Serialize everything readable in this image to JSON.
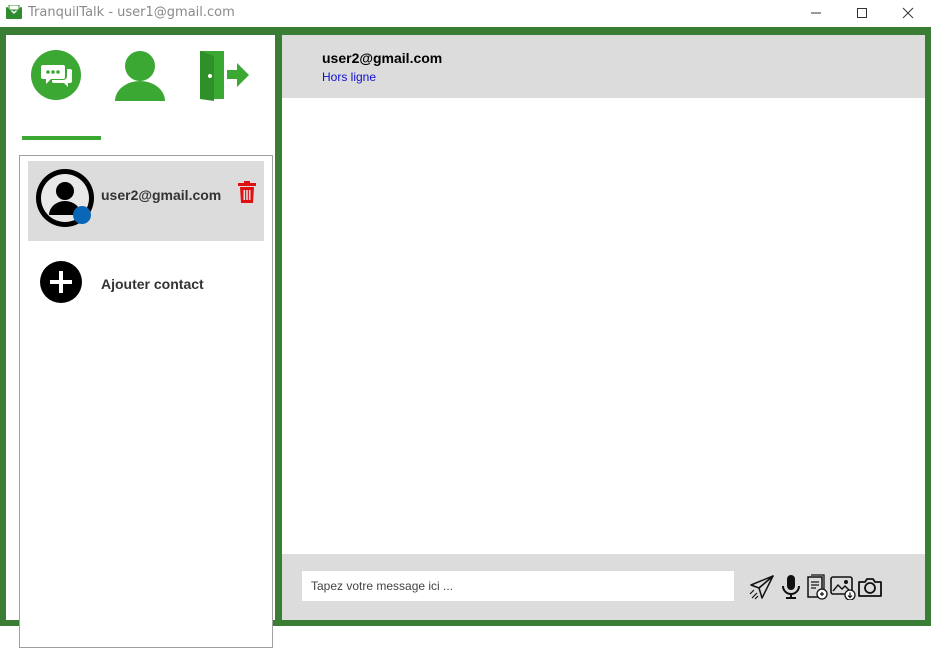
{
  "window": {
    "title": "TranquilTalk - user1@gmail.com",
    "controls": [
      "minimize-icon",
      "maximize-icon",
      "close-icon"
    ]
  },
  "sidebar": {
    "nav": [
      {
        "icon": "chat-bubbles-icon",
        "active": true
      },
      {
        "icon": "user-profile-icon",
        "active": false
      },
      {
        "icon": "logout-door-icon",
        "active": false
      }
    ],
    "contacts": [
      {
        "name": "user2@gmail.com",
        "avatar_icon": "user-avatar-icon",
        "status_dot_color": "#0a67b7",
        "delete_icon": "trash-icon"
      }
    ],
    "add_contact_label": "Ajouter contact"
  },
  "chat": {
    "header_user": "user2@gmail.com",
    "header_status": "Hors ligne",
    "messages": [],
    "input_placeholder": "Tapez votre message ici ...",
    "tools": [
      "send-icon",
      "microphone-icon",
      "document-icon",
      "image-icon",
      "camera-icon"
    ]
  },
  "colors": {
    "frame_green": "#3a7d34",
    "icon_green": "#3aa832",
    "panel_gray": "#dcdcdc",
    "status_blue": "#1010d0",
    "delete_red": "#e01010"
  }
}
